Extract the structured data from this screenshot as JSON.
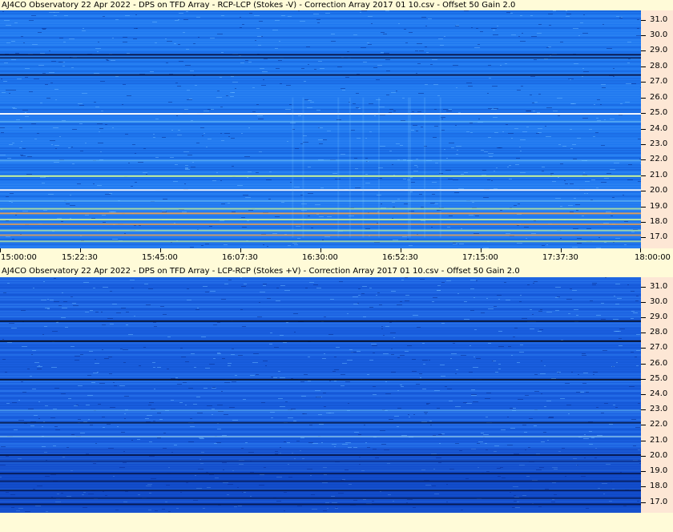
{
  "chart_data": [
    {
      "type": "heatmap",
      "title": "AJ4CO Observatory 22 Apr 2022  -  DPS on TFD Array  -  RCP-LCP (Stokes -V)  -  Correction Array 2017 01 10.csv  -  Offset 50  Gain 2.0",
      "x_tick_labels": [
        "15:00:00",
        "15:22:30",
        "15:45:00",
        "16:07:30",
        "16:30:00",
        "16:52:30",
        "17:15:00",
        "17:37:30",
        "18:00:00"
      ],
      "y_tick_labels": [
        "31.0",
        "30.0",
        "29.0",
        "28.0",
        "27.0",
        "26.0",
        "25.0",
        "24.0",
        "23.0",
        "22.0",
        "21.0",
        "20.0",
        "19.0",
        "18.0",
        "17.0"
      ],
      "y_values": [
        31.0,
        30.0,
        29.0,
        28.0,
        27.0,
        26.0,
        25.0,
        24.0,
        23.0,
        22.0,
        21.0,
        20.0,
        19.0,
        18.0,
        17.0
      ],
      "ylim": [
        16.3,
        31.6
      ],
      "colors": {
        "background": "#1f78f0",
        "bright_line": "#c8f59a",
        "hot_line": "#f0a04a",
        "dark_line": "#08204a"
      }
    },
    {
      "type": "heatmap",
      "title": "AJ4CO Observatory 22 Apr 2022  -  DPS on TFD Array  -  LCP-RCP (Stokes +V)  -  Correction Array 2017 01 10.csv  -  Offset 50  Gain 2.0",
      "y_tick_labels": [
        "31.0",
        "30.0",
        "29.0",
        "28.0",
        "27.0",
        "26.0",
        "25.0",
        "24.0",
        "23.0",
        "22.0",
        "21.0",
        "20.0",
        "19.0",
        "18.0",
        "17.0"
      ],
      "y_values": [
        31.0,
        30.0,
        29.0,
        28.0,
        27.0,
        26.0,
        25.0,
        24.0,
        23.0,
        22.0,
        21.0,
        20.0,
        19.0,
        18.0,
        17.0
      ],
      "ylim": [
        16.3,
        31.6
      ],
      "colors": {
        "background": "#1a5fe0",
        "bright_line": "#a8e0f0",
        "dark_line": "#061028"
      }
    }
  ]
}
